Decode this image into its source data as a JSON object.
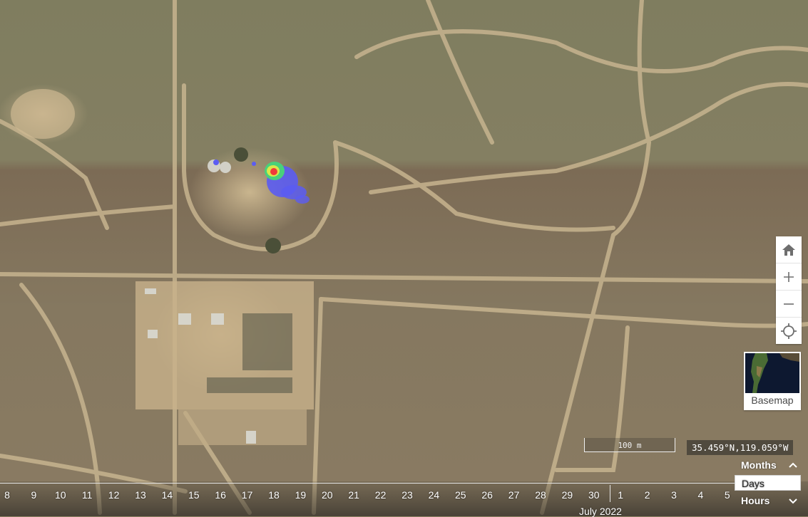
{
  "map": {
    "icons": {
      "home": "home-icon",
      "zoom_in": "plus-icon",
      "zoom_out": "minus-icon",
      "locate": "crosshair-icon"
    },
    "plume_colors": [
      "#5b5cf2",
      "#49d17a",
      "#d8e84a",
      "#f0393a"
    ],
    "basemap_label": "Basemap",
    "scale_label": "100 m",
    "coordinates": "35.459°N,119.059°W"
  },
  "timeline": {
    "days": [
      "8",
      "9",
      "10",
      "11",
      "12",
      "13",
      "14",
      "15",
      "16",
      "17",
      "18",
      "19",
      "20",
      "21",
      "22",
      "23",
      "24",
      "25",
      "26",
      "27",
      "28",
      "29",
      "30",
      "1",
      "2",
      "3",
      "4",
      "5"
    ],
    "month_label": "July 2022",
    "zoom_levels": [
      {
        "label": "Months",
        "chevron": "chevron-up-icon"
      },
      {
        "label": "Days",
        "chevron": ""
      },
      {
        "label": "Hours",
        "chevron": "chevron-down-icon"
      }
    ]
  }
}
